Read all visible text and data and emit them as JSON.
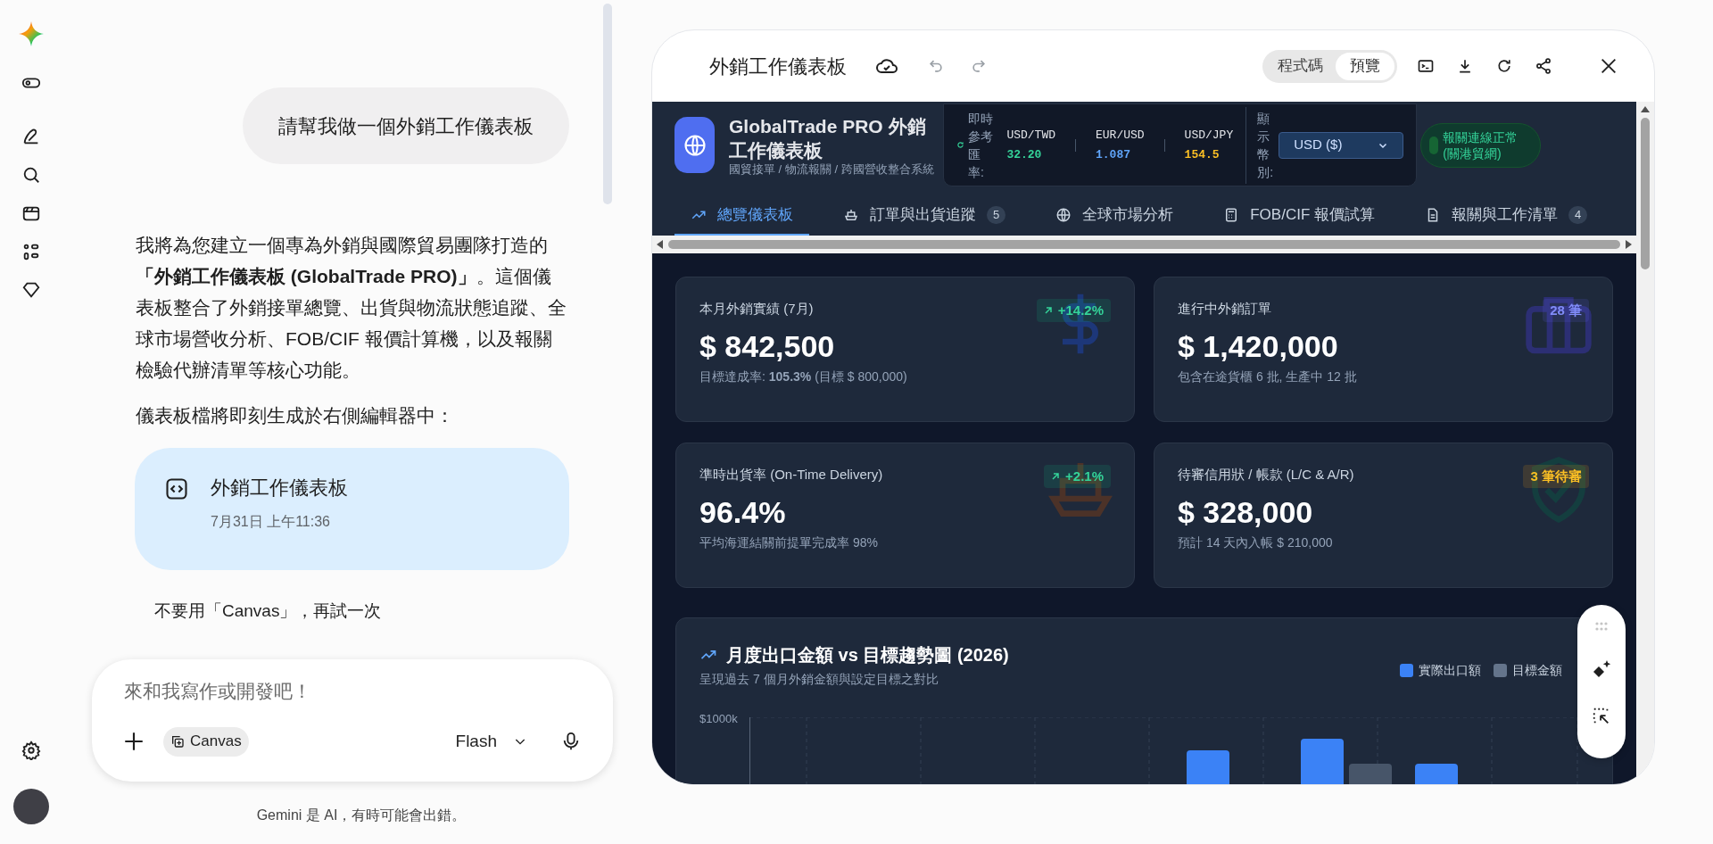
{
  "chat": {
    "user_message": "請幫我做一個外銷工作儀表板",
    "assistant_paragraphs": [
      "我將為您建立一個專為外銷與國際貿易團隊打造的**「外銷工作儀表板 (GlobalTrade PRO)」**。這個儀表板整合了外銷接單總覽、出貨與物流狀態追蹤、全球市場營收分析、FOB/CIF 報價計算機，以及報關檢驗代辦清單等核心功能。",
      "儀表板檔將即刻生成於右側編輯器中："
    ],
    "artifact": {
      "title": "外銷工作儀表板",
      "time": "7月31日 上午11:36"
    },
    "suggestion": "不要用「Canvas」，再試一次",
    "input": {
      "placeholder": "來和我寫作或開發吧！",
      "tool_chip": "Canvas",
      "model": "Flash"
    },
    "disclaimer": "Gemini 是 AI，有時可能會出錯。"
  },
  "canvas": {
    "title": "外銷工作儀表板",
    "view_toggle": [
      {
        "label": "程式碼",
        "selected": false
      },
      {
        "label": "預覽",
        "selected": true
      }
    ],
    "dashboard": {
      "brand": {
        "title": "GlobalTrade PRO 外銷工作儀表板",
        "subtitle": "國貿接單 / 物流報關 / 跨國營收整合系統"
      },
      "rates": {
        "label": "即時參考匯率:",
        "items": [
          {
            "pair": "USD/TWD",
            "value": "32.20",
            "color": "#34d399"
          },
          {
            "pair": "EUR/USD",
            "value": "1.087",
            "color": "#60a5fa"
          },
          {
            "pair": "USD/JPY",
            "value": "154.5",
            "color": "#fbbf24"
          }
        ]
      },
      "currency": {
        "label": "顯示幣別:",
        "value": "USD ($)"
      },
      "status": {
        "label": "報關連線正常(關港貿網)",
        "on": true
      },
      "tabs": [
        {
          "label": "總覽儀表板",
          "selected": true,
          "kind": "trend"
        },
        {
          "label": "訂單與出貨追蹤",
          "badge": "5",
          "selected": false,
          "kind": "ship"
        },
        {
          "label": "全球市場分析",
          "selected": false,
          "kind": "globe"
        },
        {
          "label": "FOB/CIF 報價試算",
          "selected": false,
          "kind": "calc"
        },
        {
          "label": "報關與工作清單",
          "badge": "4",
          "selected": false,
          "kind": "doc"
        }
      ],
      "kpis": [
        {
          "title": "本月外銷實績 (7月)",
          "value": "$ 842,500",
          "note": "目標達成率: **105.3%** (目標 $ 800,000)",
          "badge": "+14.2%",
          "kind": "up"
        },
        {
          "title": "進行中外銷訂單",
          "value": "$ 1,420,000",
          "note": "包含在途貨櫃 6 批, 生產中 12 批",
          "badge": "28 筆",
          "kind": "info"
        },
        {
          "title": "準時出貨率 (On-Time Delivery)",
          "value": "96.4%",
          "note": "平均海運結關前提單完成率 98%",
          "badge": "+2.1%",
          "kind": "up"
        },
        {
          "title": "待審信用狀 / 帳款 (L/C & A/R)",
          "value": "$ 328,000",
          "note": "預計 14 天內入帳 $ 210,000",
          "badge": "3 筆待審",
          "kind": "warn"
        }
      ],
      "chart": {
        "title": "月度出口金額 vs 目標趨勢圖 (2026)",
        "subtitle": "呈現過去 7 個月外銷金額與設定目標之對比",
        "legend": [
          {
            "label": "實際出口額",
            "color": "#3b82f6"
          },
          {
            "label": "目標金額",
            "color": "#64748b"
          }
        ],
        "y_tick": "$1000k"
      }
    }
  }
}
